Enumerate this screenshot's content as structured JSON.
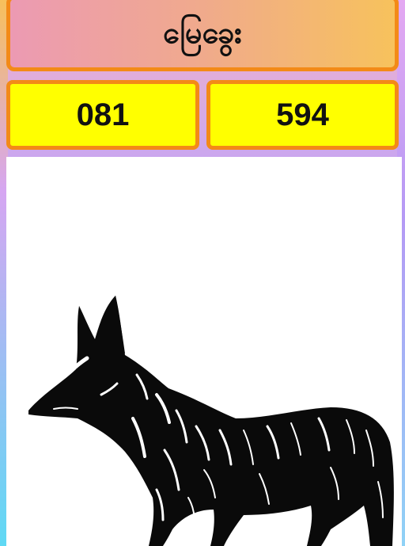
{
  "header": {
    "title": "မြေခွေး"
  },
  "numbers": [
    {
      "value": "081"
    },
    {
      "value": "594"
    }
  ],
  "illustration": {
    "icon": "dog-illustration-icon"
  }
}
